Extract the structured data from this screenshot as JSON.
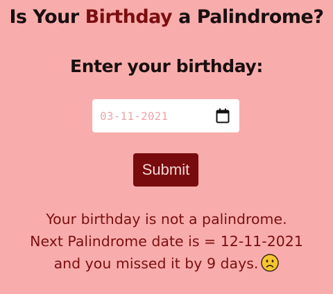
{
  "header": {
    "title_prefix": "Is Your ",
    "title_accent": "Birthday",
    "title_suffix": " a Palindrome?"
  },
  "form": {
    "prompt": "Enter your birthday:",
    "date_value": "03-11-2021",
    "submit_label": "Submit"
  },
  "result": {
    "line1": "Your birthday is not a palindrome.",
    "line2": "Next Palindrome date is = 12-11-2021",
    "line3": "and you missed it by 9 days.",
    "emoji_icon": "worried-face-icon"
  },
  "colors": {
    "background": "#f8adac",
    "accent": "#7b0e10",
    "button": "#780b0d"
  }
}
